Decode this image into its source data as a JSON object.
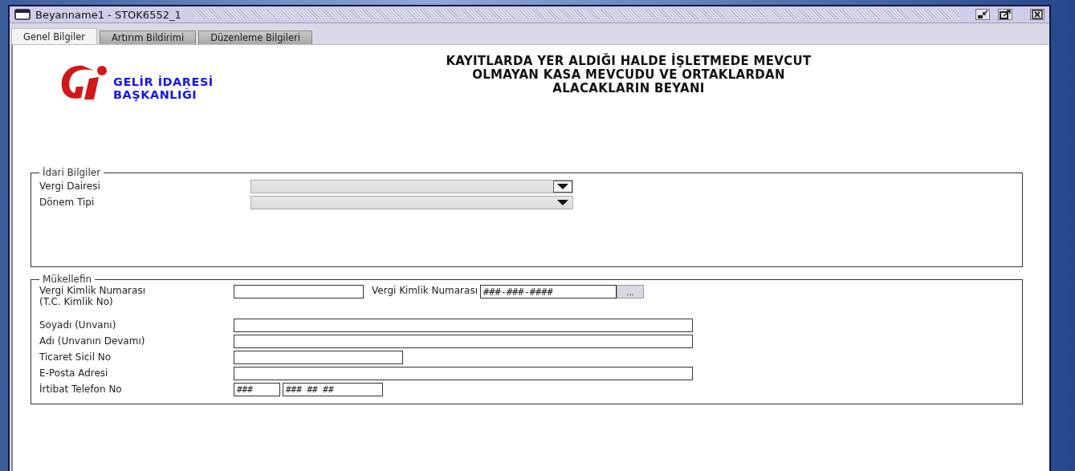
{
  "window": {
    "title": "Beyanname1 - STOK6552_1"
  },
  "tabs": [
    {
      "label": "Genel Bilgiler",
      "selected": true
    },
    {
      "label": "Artırım Bildirimi",
      "selected": false
    },
    {
      "label": "Düzenleme Bilgileri",
      "selected": false
    }
  ],
  "logo": {
    "line_1": "GELİR İDARESİ",
    "line_2": "BAŞKANLIĞI"
  },
  "form_title": [
    "KAYITLARDA YER ALDIĞI HALDE İŞLETMEDE MEVCUT",
    "OLMAYAN KASA MEVCUDU VE ORTAKLARDAN",
    "ALACAKLARIN BEYANI"
  ],
  "admin_group": {
    "title": "İdari Bilgiler",
    "fields": [
      {
        "label": "Vergi Dairesi",
        "boxed_arrow": true
      },
      {
        "label": "Dönem Tipi",
        "boxed_arrow": false
      }
    ]
  },
  "taxpayer_group": {
    "title": "Mükellefin",
    "rows": [
      {
        "kind": "id-pair",
        "label": "Vergi Kimlik Numarası",
        "sublabel": "(T.C. Kimlik No)",
        "second_label": "Vergi Kimlik Numarası",
        "second_value": "###-###-####",
        "button": "..."
      },
      {
        "kind": "wide",
        "label": "Soyadı (Unvanı)"
      },
      {
        "kind": "wide",
        "label": "Adı (Unvanın Devamı)"
      },
      {
        "kind": "medium",
        "label": "Ticaret Sicil No"
      },
      {
        "kind": "wide",
        "label": "E-Posta Adresi"
      },
      {
        "kind": "phone",
        "label": "İrtibat Telefon No",
        "area_value": "###",
        "number_value": "### ## ##"
      }
    ]
  }
}
